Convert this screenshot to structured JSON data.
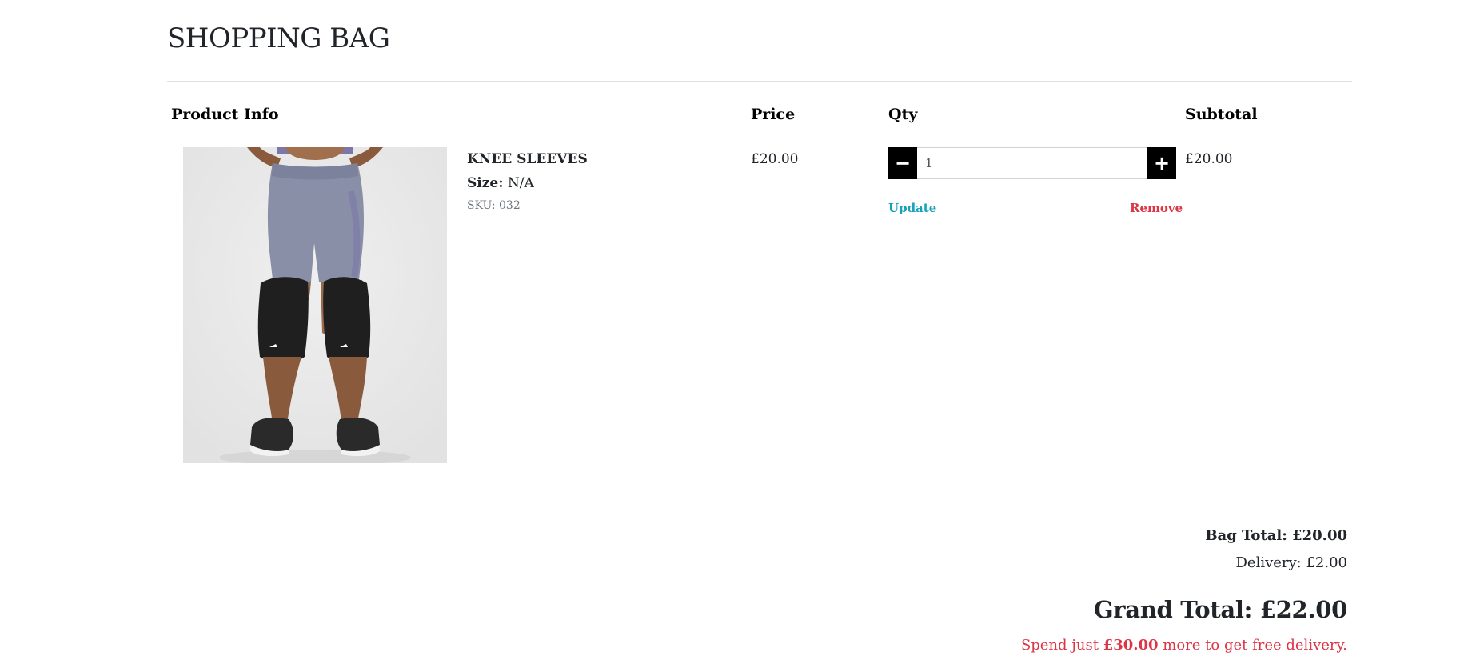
{
  "page": {
    "title": "SHOPPING BAG"
  },
  "table": {
    "headers": {
      "product_info": "Product Info",
      "price": "Price",
      "qty": "Qty",
      "subtotal": "Subtotal"
    },
    "items": [
      {
        "name": "KNEE SLEEVES",
        "size_label": "Size:",
        "size_value": "N/A",
        "sku": "SKU: 032",
        "price": "£20.00",
        "qty": "1",
        "subtotal": "£20.00",
        "update_label": "Update",
        "remove_label": "Remove",
        "decrement_icon": "minus-icon",
        "increment_icon": "plus-icon"
      }
    ]
  },
  "summary": {
    "bag_total": "Bag Total: £20.00",
    "delivery": "Delivery: £2.00",
    "grand_total": "Grand Total: £22.00",
    "free_delivery_prefix": "Spend just ",
    "free_delivery_amount": "£30.00",
    "free_delivery_suffix": " more to get free delivery."
  },
  "colors": {
    "update_link": "#17a2b8",
    "remove_link": "#dc3545",
    "free_delivery": "#dc3545",
    "qty_button": "#000000"
  }
}
